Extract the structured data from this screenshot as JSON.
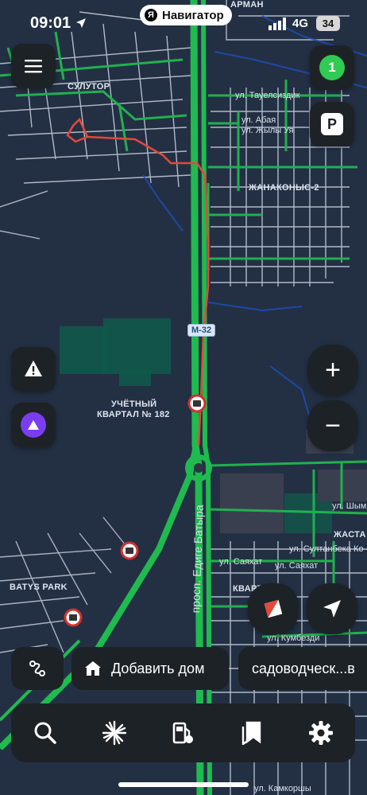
{
  "status_bar": {
    "time": "09:01",
    "network": "4G",
    "battery": "34"
  },
  "app": {
    "logo_letter": "Я",
    "name": "Навигатор"
  },
  "map": {
    "labels": {
      "arman": "АРМАН",
      "sulutor": "СУЛУТОР",
      "tauelsizdik": "ул. Тауелсиздик",
      "abaya": "ул. Абая",
      "zhyly_uya": "ул. Жылы Уя",
      "zhanakonys": "ЖАНАКОНЫС-2",
      "m32": "М-32",
      "uchetny_line1": "УЧЁТНЫЙ",
      "uchetny_line2": "КВАРТАЛ № 182",
      "batys_park": "BATYS PARK",
      "edige": "просп. Едиге Батыра",
      "shym": "ул. Шым",
      "zhasta": "ЖАСТА",
      "sultanbek": "ул. Султанбека Ко",
      "sayakhat1": "ул. Саяхат",
      "sayakhat2": "ул. Саяхат",
      "kvarta": "КВАРТА",
      "kumbezdi": "ул. Кумбезди",
      "kamkorshy": "ул. Камкоршы"
    }
  },
  "controls": {
    "traffic_score": "1",
    "parking_label": "P",
    "zoom_in": "+",
    "zoom_out": "−"
  },
  "chips": {
    "home": "Добавить дом",
    "destination": "садоводческ...в"
  },
  "colors": {
    "map_bg": "#233044",
    "road_green": "#1fbb4f",
    "route": "#e3483c",
    "panel": "#1d2227",
    "alice": "#7b3df0",
    "traffic_badge": "#2fcb52"
  }
}
